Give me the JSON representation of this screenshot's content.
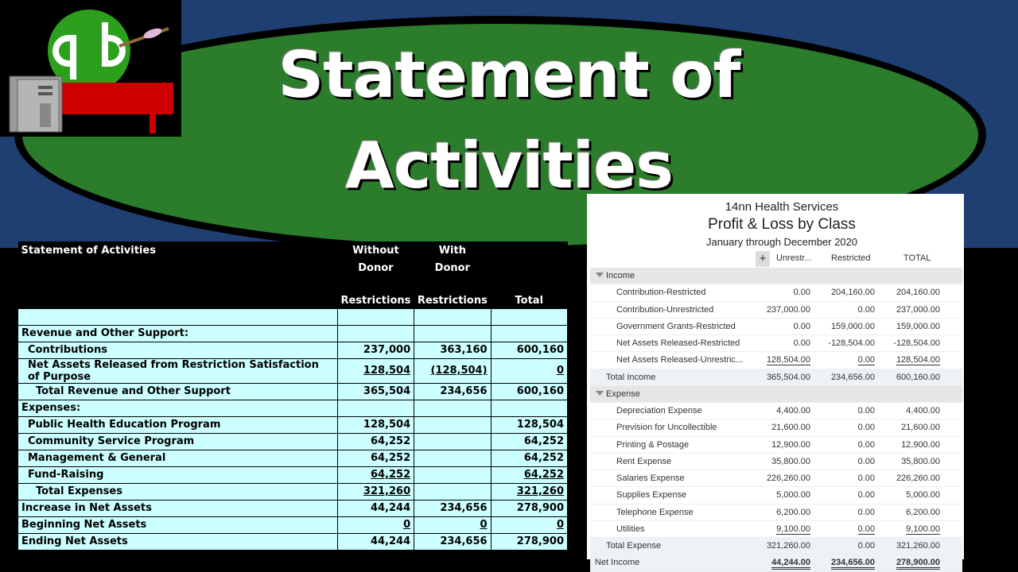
{
  "slide": {
    "title_line1": "Statement of",
    "title_line2": "Activities"
  },
  "soa": {
    "title": "Statement of Activities",
    "col1_top": "Without",
    "col1_mid": "Donor",
    "col1_bot": "Restrictions",
    "col2_top": "With",
    "col2_mid": "Donor",
    "col2_bot": "Restrictions",
    "col3": "Total",
    "rows": [
      {
        "label": "Revenue and Other Support:",
        "a": "",
        "b": "",
        "c": ""
      },
      {
        "label": "Contributions",
        "a": "237,000",
        "b": "363,160",
        "c": "600,160"
      },
      {
        "label": "Net Assets Released from Restriction Satisfaction of Purpose",
        "a": "128,504",
        "b": "(128,504)",
        "c": "0"
      },
      {
        "label": "Total Revenue and Other Support",
        "a": "365,504",
        "b": "234,656",
        "c": "600,160"
      },
      {
        "label": "Expenses:",
        "a": "",
        "b": "",
        "c": ""
      },
      {
        "label": "Public Health Education Program",
        "a": "128,504",
        "b": "",
        "c": "128,504"
      },
      {
        "label": "Community Service Program",
        "a": "64,252",
        "b": "",
        "c": "64,252"
      },
      {
        "label": "Management & General",
        "a": "64,252",
        "b": "",
        "c": "64,252"
      },
      {
        "label": "Fund-Raising",
        "a": "64,252",
        "b": "",
        "c": "64,252"
      },
      {
        "label": "Total Expenses",
        "a": "321,260",
        "b": "",
        "c": "321,260"
      },
      {
        "label": "Increase in Net Assets",
        "a": "44,244",
        "b": "234,656",
        "c": "278,900"
      },
      {
        "label": "Beginning Net Assets",
        "a": "0",
        "b": "0",
        "c": "0"
      },
      {
        "label": "Ending Net Assets",
        "a": "44,244",
        "b": "234,656",
        "c": "278,900"
      }
    ]
  },
  "report": {
    "company": "14nn Health Services",
    "title": "Profit & Loss by Class",
    "period": "January through December 2020",
    "plus": "+",
    "col1": "Unrestr...",
    "col2": "Restricted",
    "col3": "TOTAL",
    "rows": [
      {
        "label": "Income",
        "a": "",
        "b": "",
        "c": ""
      },
      {
        "label": "Contribution-Restricted",
        "a": "0.00",
        "b": "204,160.00",
        "c": "204,160.00"
      },
      {
        "label": "Contribution-Unrestricted",
        "a": "237,000.00",
        "b": "0.00",
        "c": "237,000.00"
      },
      {
        "label": "Government Grants-Restricted",
        "a": "0.00",
        "b": "159,000.00",
        "c": "159,000.00"
      },
      {
        "label": "Net Assets Released-Restricted",
        "a": "0.00",
        "b": "-128,504.00",
        "c": "-128,504.00"
      },
      {
        "label": "Net Assets Released-Unrestric...",
        "a": "128,504.00",
        "b": "0.00",
        "c": "128,504.00"
      },
      {
        "label": "Total Income",
        "a": "365,504.00",
        "b": "234,656.00",
        "c": "600,160.00"
      },
      {
        "label": "Expense",
        "a": "",
        "b": "",
        "c": ""
      },
      {
        "label": "Depreciation Expense",
        "a": "4,400.00",
        "b": "0.00",
        "c": "4,400.00"
      },
      {
        "label": "Prevision for Uncollectible",
        "a": "21,600.00",
        "b": "0.00",
        "c": "21,600.00"
      },
      {
        "label": "Printing & Postage",
        "a": "12,900.00",
        "b": "0.00",
        "c": "12,900.00"
      },
      {
        "label": "Rent Expense",
        "a": "35,800.00",
        "b": "0.00",
        "c": "35,800.00"
      },
      {
        "label": "Salaries Expense",
        "a": "226,260.00",
        "b": "0.00",
        "c": "226,260.00"
      },
      {
        "label": "Supplies Expense",
        "a": "5,000.00",
        "b": "0.00",
        "c": "5,000.00"
      },
      {
        "label": "Telephone Expense",
        "a": "6,200.00",
        "b": "0.00",
        "c": "6,200.00"
      },
      {
        "label": "Utilities",
        "a": "9,100.00",
        "b": "0.00",
        "c": "9,100.00"
      },
      {
        "label": "Total Expense",
        "a": "321,260.00",
        "b": "0.00",
        "c": "321,260.00"
      },
      {
        "label": "Net Income",
        "a": "44,244.00",
        "b": "234,656.00",
        "c": "278,900.00"
      }
    ]
  },
  "colors": {
    "band": "#1f3f73",
    "ellipse": "#2b7d2b",
    "table_fill": "#ccffff",
    "logo_green": "#2ca01c",
    "logo_red": "#cc0000"
  },
  "icons": [
    "quickbooks-logo-icon",
    "computer-tower-icon",
    "desk-icon"
  ]
}
